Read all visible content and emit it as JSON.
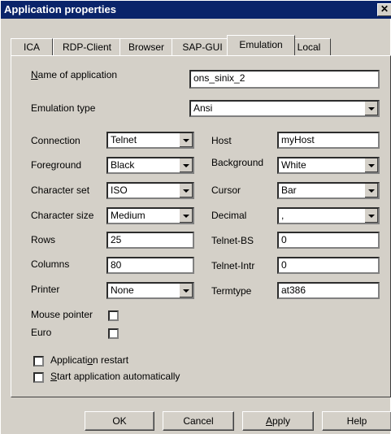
{
  "window": {
    "title": "Application properties",
    "close_label": "✕"
  },
  "tabs": [
    "ICA",
    "RDP-Client",
    "Browser",
    "SAP-GUI",
    "Emulation",
    "Local"
  ],
  "active_tab": "Emulation",
  "form": {
    "app_name": {
      "label_prefix": "N",
      "label_rest": "ame of application",
      "value": "ons_sinix_2"
    },
    "emulation_type": {
      "label": "Emulation type",
      "value": "Ansi"
    },
    "connection": {
      "label": "Connection",
      "value": "Telnet"
    },
    "host": {
      "label": "Host",
      "value": "myHost"
    },
    "foreground": {
      "label": "Foreground",
      "value": "Black"
    },
    "background": {
      "label": "Background",
      "value": "White"
    },
    "charset": {
      "label": "Character set",
      "value": "ISO"
    },
    "cursor": {
      "label": "Cursor",
      "value": "Bar"
    },
    "charsize": {
      "label": "Character size",
      "value": "Medium"
    },
    "decimal": {
      "label": "Decimal",
      "value": ","
    },
    "rows": {
      "label": "Rows",
      "value": "25"
    },
    "telnet_bs": {
      "label": "Telnet-BS",
      "value": "0"
    },
    "columns": {
      "label": "Columns",
      "value": "80"
    },
    "telnet_intr": {
      "label": "Telnet-Intr",
      "value": "0"
    },
    "printer": {
      "label": "Printer",
      "value": "None"
    },
    "termtype": {
      "label": "Termtype",
      "value": "at386"
    },
    "mouse_pointer": {
      "label": "Mouse pointer",
      "checked": false
    },
    "euro": {
      "label": "Euro",
      "checked": false
    },
    "app_restart": {
      "label_a": "Applicati",
      "label_u": "o",
      "label_b": "n restart",
      "checked": false
    },
    "start_auto": {
      "label_u": "S",
      "label_rest": "tart application automatically",
      "checked": false
    }
  },
  "buttons": {
    "ok": "OK",
    "cancel": "Cancel",
    "apply_u": "A",
    "apply_rest": "pply",
    "help": "Help"
  }
}
